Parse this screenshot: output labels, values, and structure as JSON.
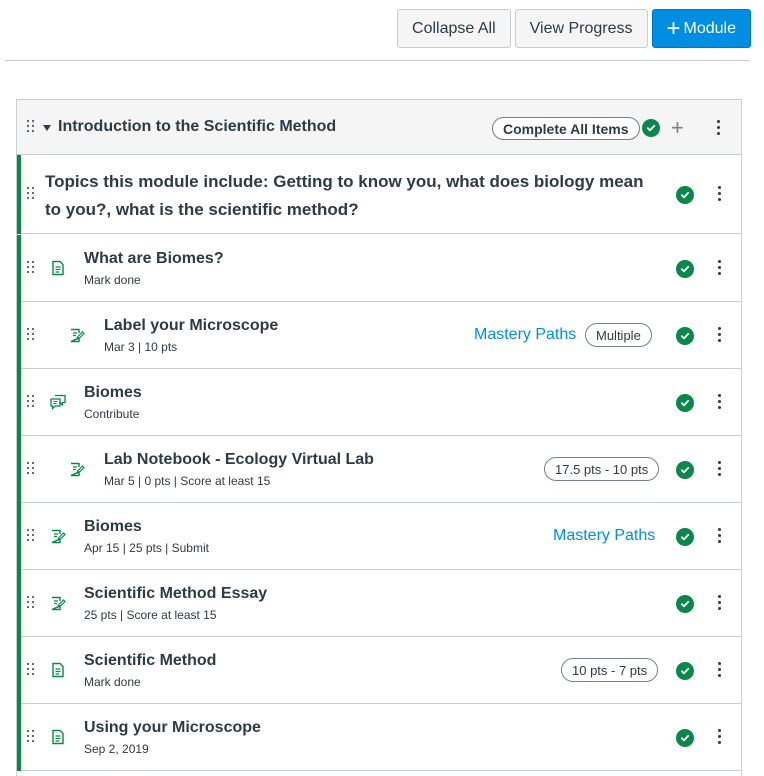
{
  "toolbar": {
    "collapse_all": "Collapse All",
    "view_progress": "View Progress",
    "add_module_plus": "+",
    "add_module": "Module"
  },
  "module": {
    "title": "Introduction to the Scientific Method",
    "complete_all": "Complete All Items",
    "items": [
      {
        "type": "text-header",
        "title": "Topics this module include: Getting to know you, what does biology mean to you?, what is the scientific method?"
      },
      {
        "type": "page",
        "icon": "page-icon",
        "title": "What are Biomes?",
        "meta": "Mark done"
      },
      {
        "type": "assignment",
        "icon": "assignment-icon",
        "title": "Label your Microscope",
        "meta": "Mar 3  |  10 pts",
        "link": "Mastery Paths",
        "pill": "Multiple",
        "indented": true
      },
      {
        "type": "discussion",
        "icon": "discussion-icon",
        "title": "Biomes",
        "meta": "Contribute"
      },
      {
        "type": "assignment",
        "icon": "assignment-icon",
        "title": "Lab Notebook - Ecology Virtual Lab",
        "meta": "Mar 5  |  0 pts  |  Score at least 15",
        "pill": "17.5 pts - 10 pts",
        "indented": true
      },
      {
        "type": "assignment",
        "icon": "assignment-icon",
        "title": "Biomes",
        "meta": "Apr 15  |  25 pts  |  Submit",
        "link": "Mastery Paths"
      },
      {
        "type": "assignment",
        "icon": "assignment-icon",
        "title": "Scientific Method Essay",
        "meta": "25 pts  |  Score at least 15"
      },
      {
        "type": "page",
        "icon": "page-icon",
        "title": "Scientific Method",
        "meta": "Mark done",
        "pill": "10 pts - 7 pts"
      },
      {
        "type": "page",
        "icon": "page-icon",
        "title": "Using your Microscope",
        "meta": "Sep 2, 2019"
      }
    ]
  },
  "colors": {
    "accent": "#008ee2",
    "success": "#0b874b",
    "text": "#2d3b45",
    "border": "#c7cdd1"
  }
}
